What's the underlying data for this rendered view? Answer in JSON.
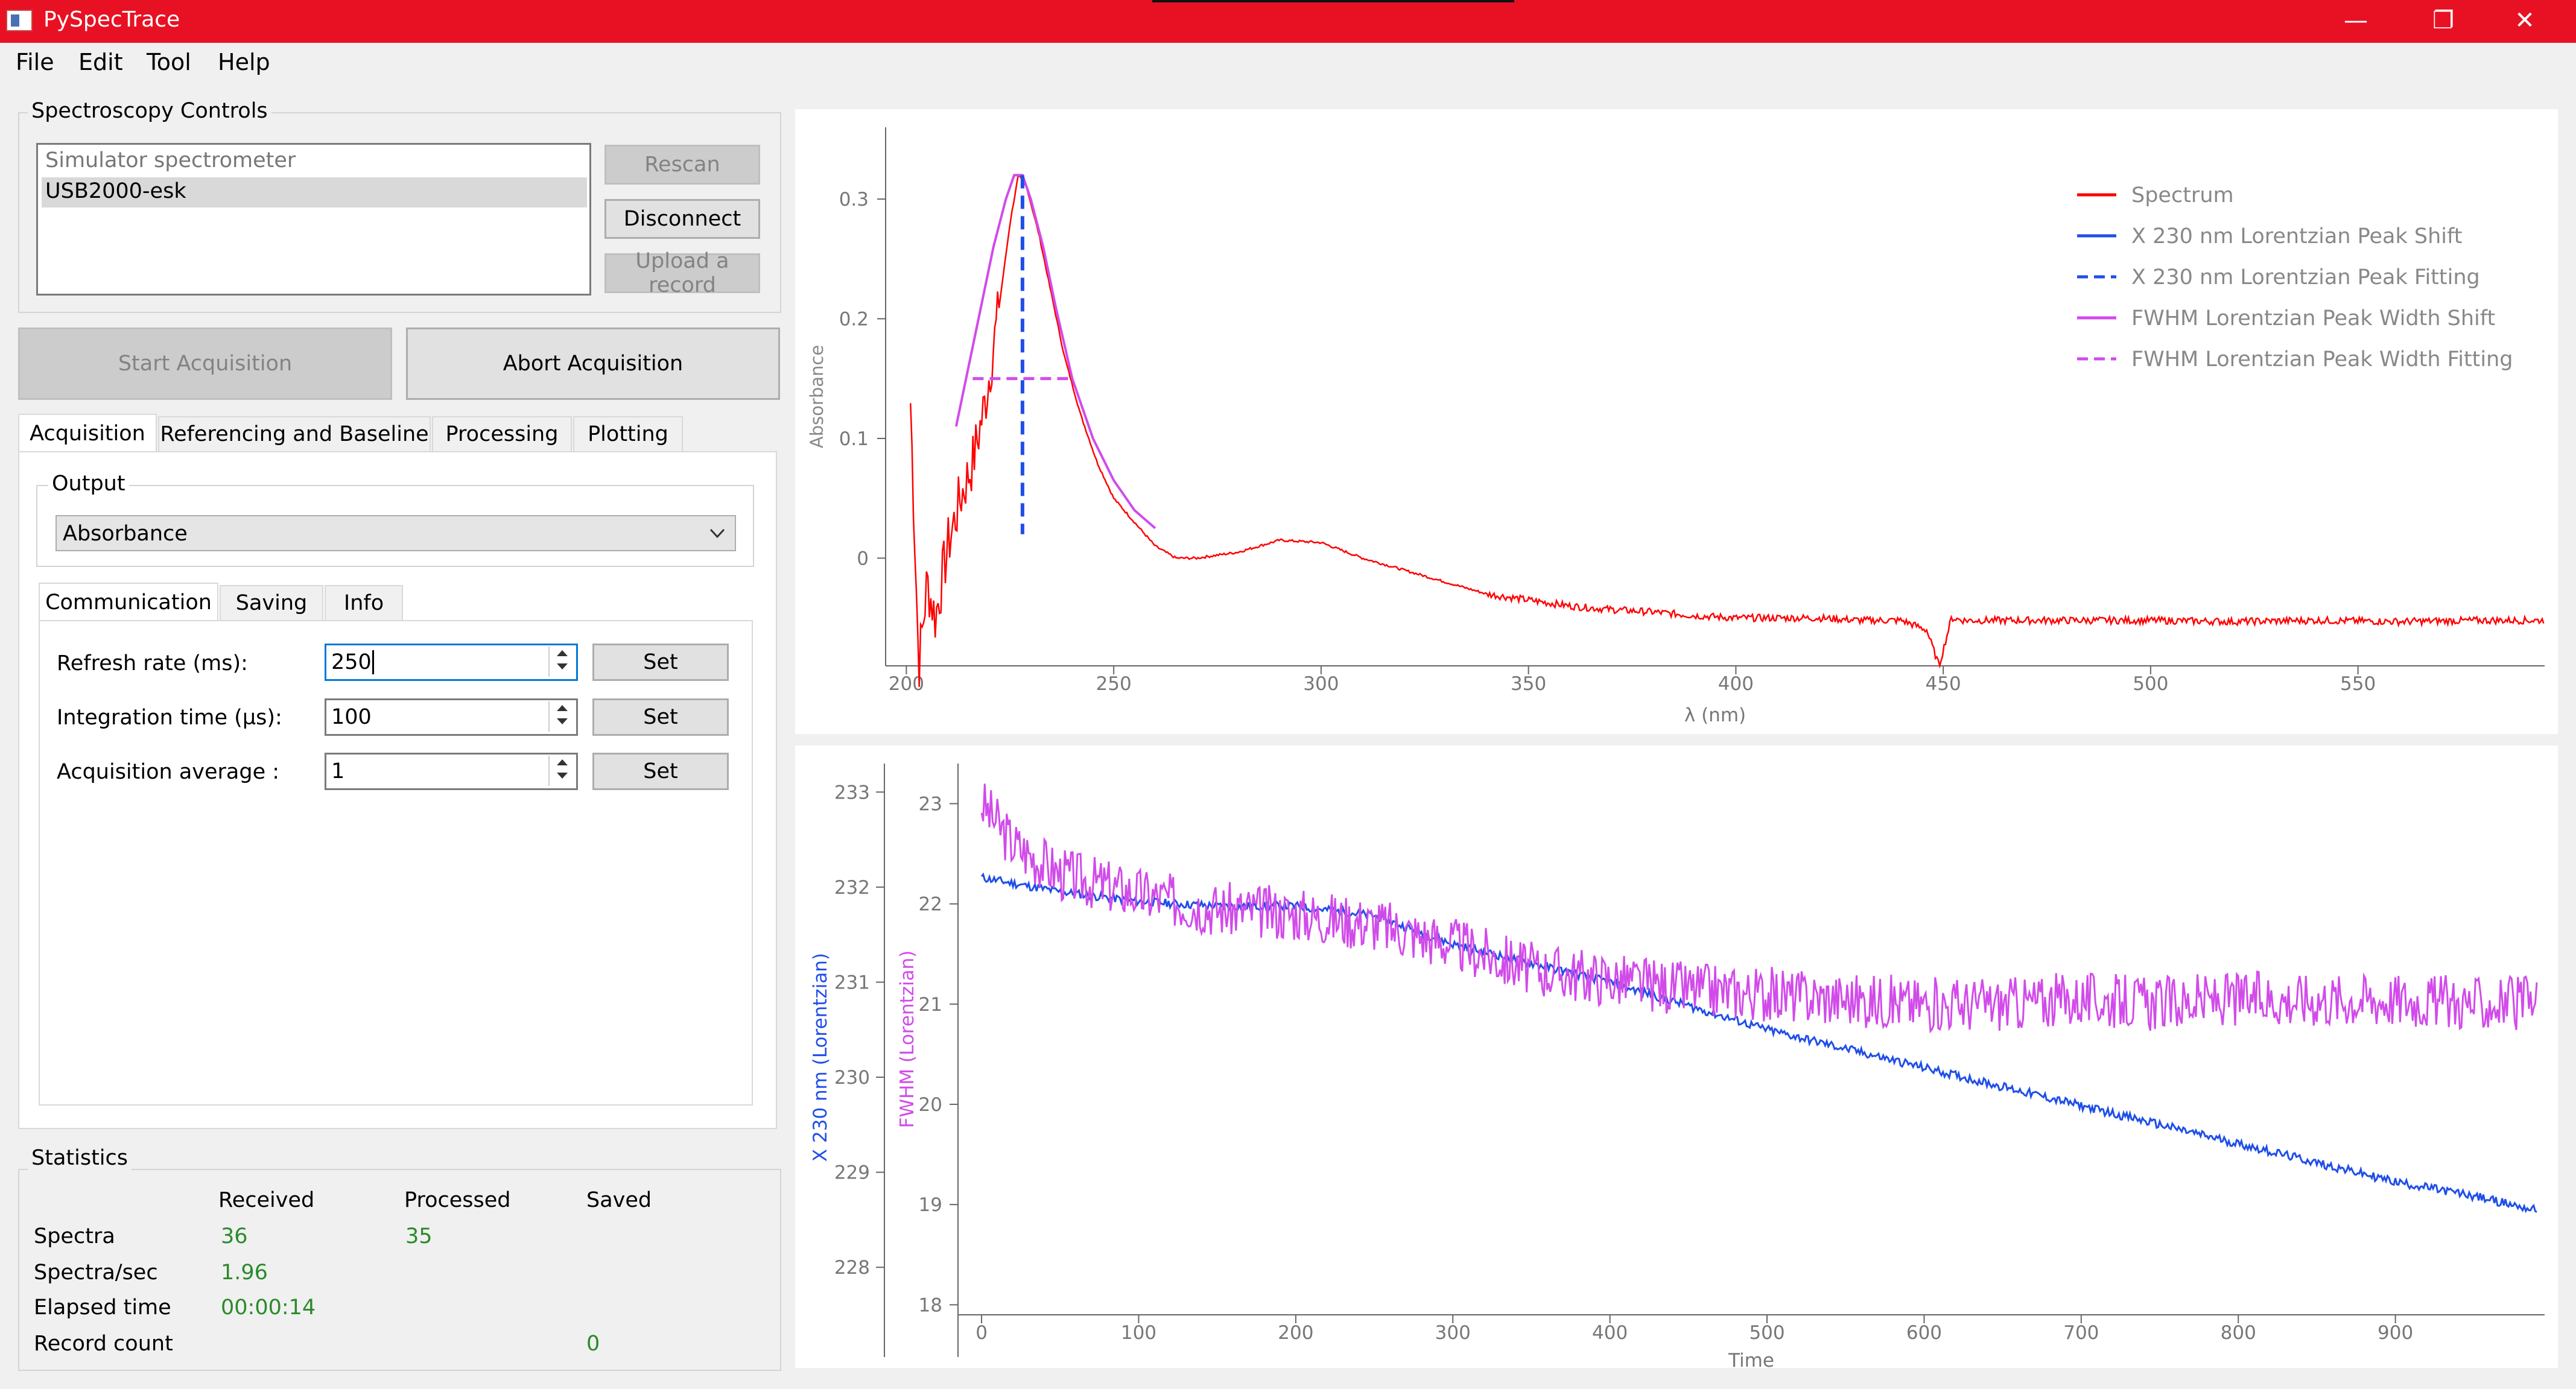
{
  "window": {
    "title": "PySpecTrace"
  },
  "menu": [
    "File",
    "Edit",
    "Tool",
    "Help"
  ],
  "controls": {
    "group_title": "Spectroscopy Controls",
    "devices": [
      "Simulator spectrometer",
      "USB2000-esk"
    ],
    "selected_device": "USB2000-esk",
    "rescan": "Rescan",
    "disconnect": "Disconnect",
    "upload": "Upload a record",
    "start": "Start Acquisition",
    "abort": "Abort Acquisition"
  },
  "tabs": [
    "Acquisition",
    "Referencing and Baseline",
    "Processing",
    "Plotting"
  ],
  "output": {
    "title": "Output",
    "value": "Absorbance"
  },
  "subtabs": [
    "Communication",
    "Saving",
    "Info"
  ],
  "fields": [
    {
      "label": "Refresh rate (ms):",
      "value": "250",
      "button": "Set"
    },
    {
      "label": "Integration time (µs):",
      "value": "100",
      "button": "Set"
    },
    {
      "label": "Acquisition average :",
      "value": "1",
      "button": "Set"
    }
  ],
  "statistics": {
    "title": "Statistics",
    "headers": [
      "Received",
      "Processed",
      "Saved"
    ],
    "rows": [
      {
        "label": "Spectra",
        "received": "36",
        "processed": "35",
        "saved": ""
      },
      {
        "label": "Spectra/sec",
        "received": "1.96",
        "processed": "",
        "saved": ""
      },
      {
        "label": "Elapsed time",
        "received": "00:00:14",
        "processed": "",
        "saved": ""
      },
      {
        "label": "Record count",
        "received": "",
        "processed": "",
        "saved": "0"
      }
    ]
  },
  "colors": {
    "titlebar": "#e81123",
    "spectrum": "#ff0000",
    "peak_shift": "#1f4ee8",
    "fwhm": "#d14bea",
    "green_text": "#2a8a2a"
  },
  "chart_data": [
    {
      "type": "line",
      "xlabel": "λ (nm)",
      "ylabel": "Absorbance",
      "xlim": [
        195,
        595
      ],
      "ylim": [
        -0.09,
        0.36
      ],
      "xticks": [
        200,
        250,
        300,
        350,
        400,
        450,
        500,
        550
      ],
      "yticks": [
        0,
        0.1,
        0.2,
        0.3
      ],
      "legend": "top-right",
      "series": [
        {
          "name": "Spectrum",
          "style": "solid",
          "x": [
            201,
            203,
            205,
            207,
            210,
            213,
            216,
            219,
            222,
            225,
            227,
            229,
            232,
            235,
            238,
            242,
            246,
            250,
            255,
            260,
            265,
            270,
            280,
            290,
            300,
            310,
            320,
            330,
            340,
            350,
            360,
            370,
            380,
            390,
            400,
            410,
            420,
            430,
            440,
            446,
            449,
            452,
            455,
            460,
            480,
            500,
            520,
            540,
            560,
            580,
            595
          ],
          "y": [
            0.13,
            -0.09,
            -0.02,
            -0.05,
            0.01,
            0.05,
            0.08,
            0.13,
            0.2,
            0.28,
            0.32,
            0.31,
            0.27,
            0.22,
            0.17,
            0.12,
            0.08,
            0.05,
            0.03,
            0.01,
            0.0,
            0.0,
            0.005,
            0.015,
            0.013,
            0.0,
            -0.01,
            -0.02,
            -0.03,
            -0.035,
            -0.04,
            -0.043,
            -0.045,
            -0.048,
            -0.05,
            -0.05,
            -0.05,
            -0.052,
            -0.052,
            -0.06,
            -0.09,
            -0.05,
            -0.052,
            -0.052,
            -0.052,
            -0.052,
            -0.053,
            -0.052,
            -0.053,
            -0.052,
            -0.052
          ]
        },
        {
          "name": "X 230 nm Lorentzian Peak Shift",
          "style": "solid",
          "x": [],
          "y": []
        },
        {
          "name": "X 230 nm Lorentzian Peak Fitting",
          "style": "dashed",
          "x": [
            228,
            228
          ],
          "y": [
            0.32,
            0.02
          ]
        },
        {
          "name": "FWHM Lorentzian Peak Width Shift",
          "style": "solid",
          "x": [
            212,
            215,
            218,
            221,
            224,
            226,
            228,
            230,
            233,
            236,
            240,
            245,
            250,
            255,
            260
          ],
          "y": [
            0.11,
            0.16,
            0.21,
            0.26,
            0.3,
            0.32,
            0.32,
            0.3,
            0.26,
            0.21,
            0.15,
            0.1,
            0.065,
            0.04,
            0.025
          ]
        },
        {
          "name": "FWHM Lorentzian Peak Width Fitting",
          "style": "dashed",
          "x": [
            216,
            240
          ],
          "y": [
            0.15,
            0.15
          ]
        }
      ]
    },
    {
      "type": "line",
      "xlabel": "Time",
      "xlim": [
        -15,
        995
      ],
      "xticks": [
        0,
        100,
        200,
        300,
        400,
        500,
        600,
        700,
        800,
        900
      ],
      "left_axis": {
        "label": "X 230 nm (Lorentzian)",
        "ylim": [
          227.5,
          233.3
        ],
        "ticks": [
          228,
          229,
          230,
          231,
          232,
          233
        ]
      },
      "right_axis": {
        "label": "FWHM (Lorentzian)",
        "ylim": [
          17.9,
          23.4
        ],
        "ticks": [
          18,
          19,
          20,
          21,
          22,
          23
        ]
      },
      "series": [
        {
          "name": "X 230 nm (Lorentzian)",
          "axis": "left",
          "x": [
            0,
            50,
            100,
            150,
            200,
            250,
            300,
            350,
            400,
            450,
            500,
            550,
            600,
            650,
            700,
            750,
            800,
            850,
            900,
            950,
            990
          ],
          "y": [
            232.1,
            231.95,
            231.85,
            231.8,
            231.8,
            231.7,
            231.4,
            231.2,
            231.0,
            230.75,
            230.5,
            230.3,
            230.1,
            229.9,
            229.7,
            229.5,
            229.3,
            229.1,
            228.9,
            228.75,
            228.6
          ]
        },
        {
          "name": "FWHM (Lorentzian)",
          "axis": "right",
          "x": [
            0,
            20,
            50,
            100,
            150,
            200,
            250,
            300,
            350,
            400,
            450,
            500,
            550,
            600,
            650,
            700,
            750,
            800,
            850,
            900,
            950,
            990
          ],
          "y": [
            23.0,
            22.6,
            22.3,
            22.1,
            21.95,
            21.9,
            21.8,
            21.6,
            21.35,
            21.25,
            21.15,
            21.1,
            21.05,
            21.0,
            21.0,
            21.05,
            21.0,
            21.05,
            21.05,
            21.05,
            21.0,
            21.0
          ]
        }
      ]
    }
  ]
}
